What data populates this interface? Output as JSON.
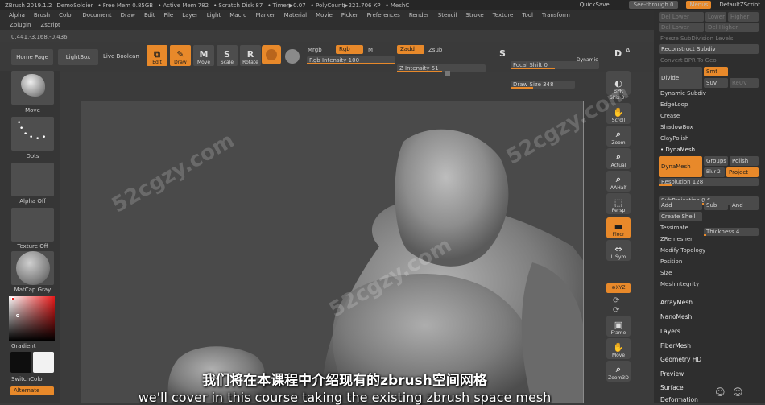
{
  "titlebar": {
    "app": "ZBrush 2019.1.2",
    "doc": "DemoSoldier",
    "free_mem": "• Free Mem 0.85GB",
    "active_mem": "• Active Mem 782",
    "scratch": "• Scratch Disk 87",
    "timer": "• Timer▶0.07",
    "polycount": "• PolyCount▶221.706 KP",
    "mesh": "• MeshC",
    "quicksave": "QuickSave",
    "seethrough": "See-through 0",
    "menus": "Menus",
    "script": "DefaultZScript"
  },
  "menu1": [
    "Alpha",
    "Brush",
    "Color",
    "Document",
    "Draw",
    "Edit",
    "File",
    "Layer",
    "Light",
    "Macro",
    "Marker",
    "Material",
    "Movie",
    "Picker",
    "Preferences",
    "Render",
    "Stencil",
    "Stroke",
    "Texture",
    "Tool",
    "Transform"
  ],
  "menu2": [
    "Zplugin",
    "Zscript"
  ],
  "coords": "0.441,-3.168,-0.436",
  "toolbar": {
    "home": "Home Page",
    "lightbox": "LightBox",
    "live_boolean": "Live Boolean",
    "edit": "Edit",
    "draw": "Draw",
    "move": "Move",
    "scale": "Scale",
    "rotate": "Rotate",
    "mrgb": "Mrgb",
    "rgb": "Rgb",
    "m": "M",
    "rgb_intensity_label": "Rgb Intensity 100",
    "rgb_intensity": 1.0,
    "zadd": "Zadd",
    "zsub": "Zsub",
    "z_intensity_label": "Z Intensity 51",
    "z_intensity": 0.51,
    "focal_label": "Focal Shift 0",
    "focal": 0.5,
    "draw_size_label": "Draw Size 348",
    "draw_size": 0.35,
    "dynamic": "Dynamic",
    "s": "S",
    "d": "D",
    "a": "A"
  },
  "left": {
    "brush": "Move",
    "stroke": "Dots",
    "alpha": "Alpha Off",
    "texture": "Texture Off",
    "material": "MatCap Gray",
    "gradient": "Gradient",
    "switchcolor": "SwitchColor",
    "alternate": "Alternate"
  },
  "right": {
    "bpr": "BPR",
    "spix": "SPix 3",
    "scroll": "Scroll",
    "zoom": "Zoom",
    "actual": "Actual",
    "aahalf": "AAHalf",
    "persp": "Persp",
    "floor": "Floor",
    "lsym": "L.Sym",
    "xyz": "XYZ",
    "frame": "Frame",
    "move": "Move",
    "zoom3d": "Zoom3D"
  },
  "panel": {
    "ghost1": "Del Lower",
    "ghost2": "Del Higher",
    "ghost3": "Freeze SubDivision Levels",
    "reconstruct": "Reconstruct Subdiv",
    "convert": "Convert BPR To Geo",
    "divide": "Divide",
    "smt": "Smt",
    "suv": "Suv",
    "relax": "ReUV",
    "higher": "Higher",
    "lower": "Lower",
    "dyn_subdiv": "Dynamic Subdiv",
    "edgeloop": "EdgeLoop",
    "crease": "Crease",
    "shadowbox": "ShadowBox",
    "claypolish": "ClayPolish",
    "dynamesh_header": "DynaMesh",
    "dynamesh_btn": "DynaMesh",
    "groups": "Groups",
    "polish": "Polish",
    "blur": "Blur 2",
    "project": "Project",
    "resolution_label": "Resolution 128",
    "resolution": 0.13,
    "subprojection_label": "SubProjection 0.6",
    "subprojection": 0.6,
    "add": "Add",
    "sub": "Sub",
    "and": "And",
    "create_shell": "Create Shell",
    "thickness_label": "Thickness 4",
    "thickness": 0.04,
    "tessimate": "Tessimate",
    "zremesher": "ZRemesher",
    "modify_topology": "Modify Topology",
    "position": "Position",
    "size": "Size",
    "meshintegrity": "MeshIntegrity",
    "arraymesh": "ArrayMesh",
    "nanomesh": "NanoMesh",
    "layers": "Layers",
    "fibermesh": "FiberMesh",
    "geometry_hd": "Geometry HD",
    "preview": "Preview",
    "surface": "Surface",
    "deformation": "Deformation"
  },
  "subtitles": {
    "zh": "我们将在本课程中介绍现有的zbrush空间网格",
    "en": "we'll cover in this course taking the existing zbrush space mesh"
  },
  "watermark": "52cgzy.com",
  "colors": {
    "accent": "#e8892a"
  }
}
